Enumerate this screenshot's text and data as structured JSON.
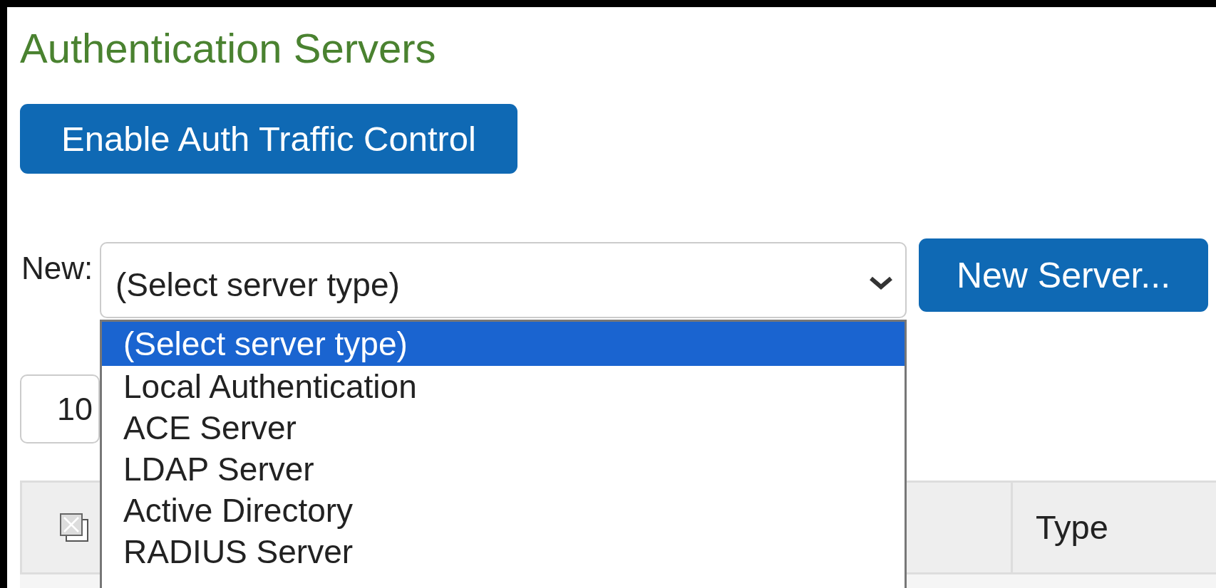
{
  "title": "Authentication Servers",
  "enable_button": {
    "label": "Enable Auth Traffic Control"
  },
  "new_server": {
    "label": "New:",
    "select": {
      "value": "(Select server type)",
      "expanded": true,
      "options": [
        {
          "label": "(Select server type)",
          "selected": true
        },
        {
          "label": "Local Authentication",
          "selected": false
        },
        {
          "label": "ACE Server",
          "selected": false
        },
        {
          "label": "LDAP Server",
          "selected": false
        },
        {
          "label": "Active Directory",
          "selected": false
        },
        {
          "label": "RADIUS Server",
          "selected": false
        }
      ]
    },
    "button": "New Server..."
  },
  "page_size": {
    "value": "10"
  },
  "table": {
    "columns": [
      {
        "kind": "select-all"
      },
      {
        "kind": "text",
        "label": "Type"
      }
    ]
  }
}
